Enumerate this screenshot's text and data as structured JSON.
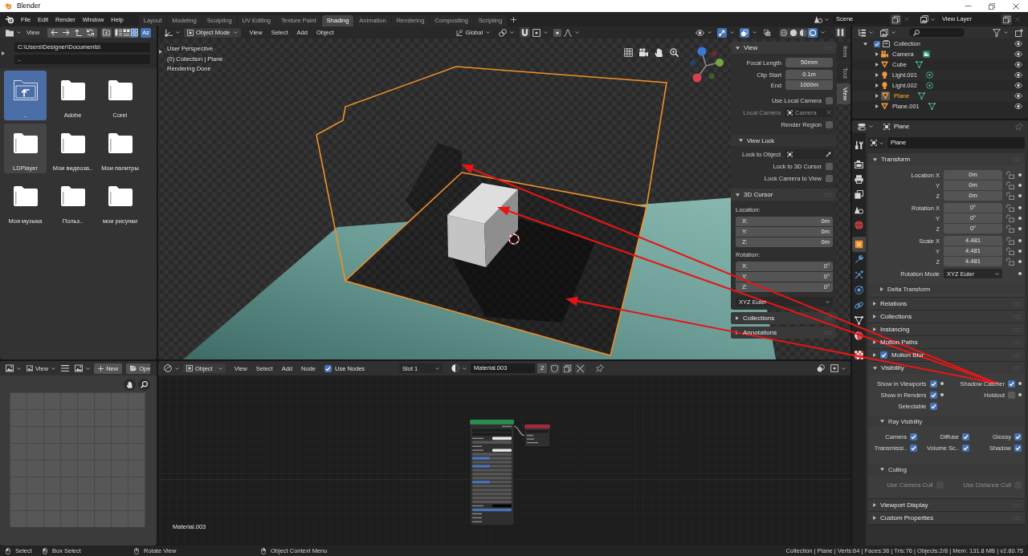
{
  "window": {
    "title": "Blender"
  },
  "top_bar": {
    "menus": [
      "File",
      "Edit",
      "Render",
      "Window",
      "Help"
    ],
    "workspaces": [
      {
        "label": "Layout",
        "selected": false
      },
      {
        "label": "Modeling",
        "selected": false
      },
      {
        "label": "Sculpting",
        "selected": false
      },
      {
        "label": "UV Editing",
        "selected": false
      },
      {
        "label": "Texture Paint",
        "selected": false
      },
      {
        "label": "Shading",
        "selected": true
      },
      {
        "label": "Animation",
        "selected": false
      },
      {
        "label": "Rendering",
        "selected": false
      },
      {
        "label": "Compositing",
        "selected": false
      },
      {
        "label": "Scripting",
        "selected": false
      }
    ],
    "scene": "Scene",
    "view_layer": "View Layer"
  },
  "file_browser": {
    "view_menu": "View",
    "display_modes": [
      {
        "kind": "vertical",
        "selected": false
      },
      {
        "kind": "horizontal",
        "selected": false
      },
      {
        "kind": "thumbnails",
        "selected": true
      }
    ],
    "sort": {
      "label": "Az",
      "selected": true
    },
    "directory": "C:\\Users\\Designer\\Documents\\",
    "filename": "..",
    "files": [
      {
        "name": "..",
        "kind": "parent",
        "selected": true,
        "hovered": false
      },
      {
        "name": "Adobe",
        "kind": "folder",
        "selected": false,
        "hovered": false
      },
      {
        "name": "Corel",
        "kind": "folder",
        "selected": false,
        "hovered": false
      },
      {
        "name": "LDPlayer",
        "kind": "folder",
        "selected": false,
        "hovered": true
      },
      {
        "name": "Мои видеоза..",
        "kind": "folder",
        "selected": false,
        "hovered": false
      },
      {
        "name": "Мои палитры",
        "kind": "folder",
        "selected": false,
        "hovered": false
      },
      {
        "name": "Моя музыка",
        "kind": "folder",
        "selected": false,
        "hovered": false
      },
      {
        "name": "Польз..",
        "kind": "folder",
        "selected": false,
        "hovered": false
      },
      {
        "name": "мои рисунки",
        "kind": "folder",
        "selected": false,
        "hovered": false
      }
    ]
  },
  "image_editor": {
    "view_menu": "View",
    "new_button": "New",
    "open_button": "Ope"
  },
  "viewport": {
    "mode": "Object Mode",
    "menus": [
      "View",
      "Select",
      "Add",
      "Object"
    ],
    "orientation": "Global",
    "toggles": [
      {
        "kind": "gizmo",
        "on": true
      },
      {
        "kind": "overlay",
        "on": true
      },
      {
        "kind": "xray",
        "on": false
      }
    ],
    "shading_modes": [
      {
        "kind": "wireframe",
        "selected": false
      },
      {
        "kind": "solid",
        "selected": false
      },
      {
        "kind": "material",
        "selected": false
      },
      {
        "kind": "rendered",
        "selected": true
      }
    ],
    "overlay_text": [
      "User Perspective",
      "(0) Collection | Plane",
      "Rendering Done"
    ],
    "sidebar": {
      "tabs": [
        {
          "label": "Item",
          "selected": false
        },
        {
          "label": "Tool",
          "selected": false
        },
        {
          "label": "View",
          "selected": true
        }
      ],
      "panels": [
        {
          "title": "View",
          "expanded": true,
          "rows": [
            {
              "kind": "number",
              "items": [
                {
                  "label": "Focal Length",
                  "value": "50mm"
                }
              ],
              "disabled": false
            },
            {
              "kind": "number",
              "items": [
                {
                  "label": "Clip Start",
                  "value": "0.1m"
                },
                {
                  "label": "End",
                  "value": "1000m"
                }
              ],
              "disabled": false
            },
            {
              "kind": "checkbox",
              "label": "Use Local Camera",
              "checked": false,
              "disabled": false
            },
            {
              "kind": "object",
              "label": "Local Camera",
              "value": "Camera",
              "disabled": true
            },
            {
              "kind": "checkbox",
              "label": "Render Region",
              "checked": false,
              "disabled": false
            }
          ],
          "subpanels": [
            {
              "title": "View Lock",
              "expanded": true,
              "rows": [
                {
                  "kind": "eyedropper",
                  "label": "Lock to Object",
                  "disabled": false
                },
                {
                  "kind": "checkbox",
                  "label": "Lock to 3D Cursor",
                  "checked": false,
                  "disabled": false
                },
                {
                  "kind": "checkbox",
                  "label": "Lock Camera to View",
                  "checked": false,
                  "disabled": false
                }
              ]
            }
          ]
        },
        {
          "title": "3D Cursor",
          "expanded": true,
          "rows": [
            {
              "kind": "caption",
              "label": "Location:",
              "disabled": false
            },
            {
              "kind": "vector",
              "items": [
                {
                  "label": "X:",
                  "value": "0m"
                },
                {
                  "label": "Y:",
                  "value": "0m"
                },
                {
                  "label": "Z:",
                  "value": "0m"
                }
              ],
              "disabled": false
            },
            {
              "kind": "caption",
              "label": "Rotation:",
              "disabled": false
            },
            {
              "kind": "vector",
              "items": [
                {
                  "label": "X:",
                  "value": "0°"
                },
                {
                  "label": "Y:",
                  "value": "0°"
                },
                {
                  "label": "Z:",
                  "value": "0°"
                }
              ],
              "disabled": false
            },
            {
              "kind": "dropdown",
              "value": "XYZ Euler",
              "disabled": false
            }
          ]
        },
        {
          "title": "Collections",
          "expanded": false
        },
        {
          "title": "Annotations",
          "expanded": false
        }
      ]
    }
  },
  "node_editor": {
    "mode": "Object",
    "menus": [
      "View",
      "Select",
      "Add",
      "Node"
    ],
    "use_nodes": {
      "label": "Use Nodes",
      "checked": true
    },
    "slot": "Slot 1",
    "material": "Material.003",
    "users": "2",
    "canvas_label": "Material.003"
  },
  "outliner": {
    "tree": [
      {
        "name": "Collection",
        "kind": "collection",
        "expanded": true,
        "selected": false,
        "checked": true,
        "children": [
          {
            "name": "Camera",
            "kind": "camera",
            "expanded": false,
            "selected": false
          },
          {
            "name": "Cube",
            "kind": "mesh",
            "expanded": false,
            "selected": false
          },
          {
            "name": "Light.001",
            "kind": "light",
            "expanded": false,
            "selected": false
          },
          {
            "name": "Light.002",
            "kind": "light",
            "expanded": false,
            "selected": false
          },
          {
            "name": "Plane",
            "kind": "mesh",
            "expanded": false,
            "selected": true
          },
          {
            "name": "Plane.001",
            "kind": "mesh",
            "expanded": false,
            "selected": false
          }
        ]
      }
    ]
  },
  "properties": {
    "object_name": "Plane",
    "tabs": [
      [
        {
          "kind": "tool",
          "selected": false
        }
      ],
      [
        {
          "kind": "render",
          "selected": false
        },
        {
          "kind": "output",
          "selected": false
        },
        {
          "kind": "view_layer",
          "selected": false
        },
        {
          "kind": "scene",
          "selected": false
        },
        {
          "kind": "world",
          "selected": false
        }
      ],
      [
        {
          "kind": "object",
          "selected": true
        },
        {
          "kind": "modifiers",
          "selected": false
        },
        {
          "kind": "particles",
          "selected": false
        },
        {
          "kind": "physics",
          "selected": false
        },
        {
          "kind": "constraints",
          "selected": false
        },
        {
          "kind": "data",
          "selected": false
        },
        {
          "kind": "material",
          "selected": false
        }
      ],
      [
        {
          "kind": "texture",
          "selected": false
        }
      ]
    ],
    "name_field": "Plane",
    "panels": [
      {
        "kind": "transform",
        "title": "Transform",
        "expanded": true,
        "groups": [
          [
            {
              "label": "Location X",
              "value": "0m"
            },
            {
              "label": "Y",
              "value": "0m"
            },
            {
              "label": "Z",
              "value": "0m"
            }
          ],
          [
            {
              "label": "Rotation X",
              "value": "0°"
            },
            {
              "label": "Y",
              "value": "0°"
            },
            {
              "label": "Z",
              "value": "0°"
            }
          ],
          [
            {
              "label": "Scale X",
              "value": "4.481"
            },
            {
              "label": "Y",
              "value": "4.481"
            },
            {
              "label": "Z",
              "value": "4.481"
            }
          ]
        ],
        "rotation_mode": {
          "label": "Rotation Mode",
          "value": "XYZ Euler"
        },
        "subpanels": [
          {
            "title": "Delta Transform",
            "expanded": false
          }
        ]
      },
      {
        "kind": "plain",
        "title": "Relations",
        "expanded": false
      },
      {
        "kind": "plain",
        "title": "Collections",
        "expanded": false
      },
      {
        "kind": "plain",
        "title": "Instancing",
        "expanded": false
      },
      {
        "kind": "plain",
        "title": "Motion Paths",
        "expanded": false
      },
      {
        "kind": "toggle",
        "title": "Motion Blur",
        "expanded": false,
        "checked": true
      },
      {
        "kind": "checks",
        "title": "Visibility",
        "expanded": true,
        "disabled": false,
        "rows": [
          [
            {
              "label": "Show in Viewports",
              "checked": true,
              "animatable": true
            },
            {
              "label": "Shadow Catcher",
              "checked": true,
              "animatable": true
            }
          ],
          [
            {
              "label": "Show in Renders",
              "checked": true,
              "animatable": true
            },
            {
              "label": "Holdout",
              "checked": false,
              "animatable": true
            }
          ],
          [
            {
              "label": "Selectable",
              "checked": true,
              "animatable": false
            }
          ]
        ],
        "subpanels": [
          {
            "title": "Ray Visibility",
            "expanded": true,
            "disabled": false,
            "rows": [
              [
                {
                  "label": "Camera",
                  "checked": true,
                  "animatable": false
                },
                {
                  "label": "Diffuse",
                  "checked": true,
                  "animatable": false
                },
                {
                  "label": "Glossy",
                  "checked": true,
                  "animatable": false
                }
              ],
              [
                {
                  "label": "Transmissi..",
                  "checked": true,
                  "animatable": false
                },
                {
                  "label": "Volume Sc..",
                  "checked": true,
                  "animatable": false
                },
                {
                  "label": "Shadow",
                  "checked": true,
                  "animatable": false
                }
              ]
            ]
          },
          {
            "title": "Culling",
            "expanded": true,
            "disabled": true,
            "rows": [
              [
                {
                  "label": "Use Camera Cull",
                  "checked": false,
                  "animatable": false
                },
                {
                  "label": "Use Distance Cull",
                  "checked": false,
                  "animatable": false
                }
              ]
            ]
          }
        ]
      },
      {
        "kind": "plain",
        "title": "Viewport Display",
        "expanded": false
      },
      {
        "kind": "plain",
        "title": "Custom Properties",
        "expanded": false
      }
    ]
  },
  "status_bar": {
    "hints": [
      {
        "kind": "left",
        "label": "Select"
      },
      {
        "kind": "drag",
        "label": "Box Select"
      },
      {
        "kind": "middle",
        "label": "Rotate View"
      },
      {
        "kind": "right",
        "label": "Object Context Menu"
      }
    ],
    "stats": "Collection | Plane | Verts:64 | Faces:36 | Tris:76 | Objects:2/8 | Mem: 131.8 MB | v2.80.75"
  }
}
